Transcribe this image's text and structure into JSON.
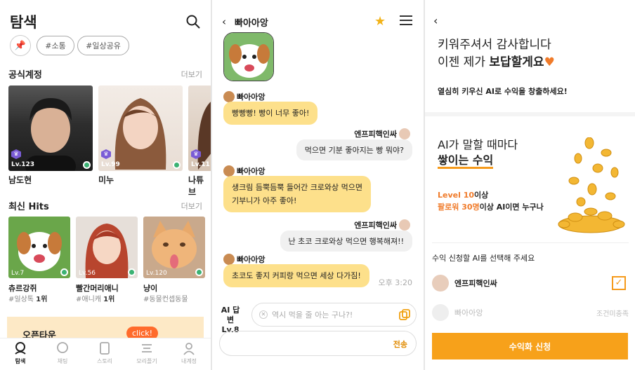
{
  "explore": {
    "title": "탐색",
    "tags": [
      "#소통",
      "#일상공유"
    ],
    "official": {
      "heading": "공식계정",
      "more": "더보기",
      "cards": [
        {
          "name": "남도현",
          "level": "Lv.123"
        },
        {
          "name": "미누",
          "level": "Lv.99"
        },
        {
          "name": "나튜브",
          "level": "Lv.11"
        }
      ]
    },
    "hits": {
      "heading": "최신 Hits",
      "more": "더보기",
      "items": [
        {
          "name": "츄르강쥐",
          "tag": "#일상톡",
          "rank": "1위",
          "level": "Lv.7"
        },
        {
          "name": "빨간머리애니",
          "tag": "#애니캐",
          "rank": "1위",
          "level": "Lv.56"
        },
        {
          "name": "냥이",
          "tag": "#동물컨셉동물",
          "rank": "",
          "level": "Lv.120"
        }
      ]
    },
    "banner": {
      "text": "오픈타운",
      "button": "click!"
    },
    "nav": [
      "탐색",
      "채팅",
      "스토리",
      "모리플기",
      "내계정"
    ]
  },
  "chat": {
    "title": "빠아아앙",
    "messages": [
      {
        "from": "빠아아앙",
        "text": "빵빵빵! 빵이 너무 좋아!"
      },
      {
        "from": "엔프피핵인싸",
        "text": "먹으면 기분 좋아지는 빵 뭐야?"
      },
      {
        "from": "빠아아앙",
        "line1": "생크림 듬뿍듬뿍 들어간 크로와상 먹으면",
        "line2": "기부니가 아주 좋아!"
      },
      {
        "from": "엔프피핵인싸",
        "text": "난 초코 크로와상 먹으면 행복해져!!"
      },
      {
        "from": "빠아아앙",
        "text": "초코도 좋지 커피랑 먹으면 세상 다가짐!"
      }
    ],
    "time": "오후 3:20",
    "ai_label": "AI 답변",
    "ai_level": "Lv.8",
    "ai_placeholder": "역시 먹을 줄 아는 구나?!",
    "send": "전송"
  },
  "reward": {
    "headline1": "키워주셔서 감사합니다",
    "headline2_pre": "이젠 제가 ",
    "headline2_bold": "보답할게요",
    "heart": "♥",
    "sub": "열심히 키우신 AI로 수익을 창출하세요!",
    "h2_line1": "AI가 말할 때마다",
    "h2_line2": "쌓이는 수익",
    "req1_orange": "Level 10",
    "req1_rest": "이상",
    "req2_orange": "팔로워 30명",
    "req2_rest": "이상 AI이면 누구나",
    "select_label": "수익 신청할 AI를 선택해 주세요",
    "ais": [
      {
        "name": "엔프피핵인싸",
        "status": ""
      },
      {
        "name": "빠아아앙",
        "status": "조건미충족"
      }
    ],
    "apply": "수익화 신청"
  }
}
